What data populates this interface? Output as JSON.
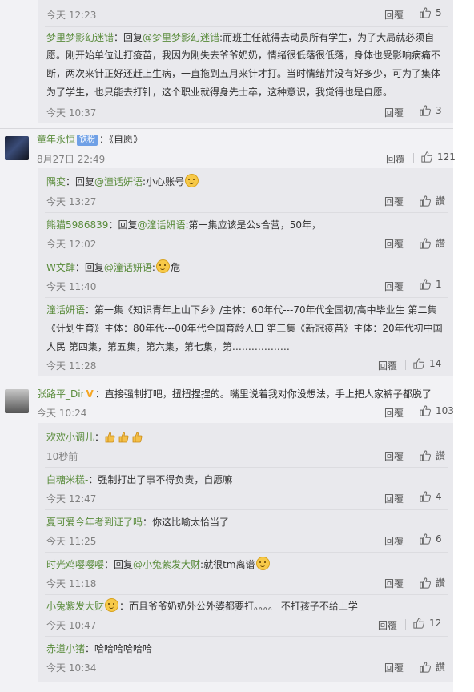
{
  "like_icon": "thumbs-up-icon",
  "reply_label": "回覆",
  "zan_label": "讚",
  "comments": [
    {
      "replies_top": [
        {
          "time": "今天 12:23",
          "likes": "5"
        },
        {
          "user": "梦里梦影幻迷错",
          "prefix": "：回复",
          "at": "@梦里梦影幻迷错",
          "text_lines": [
            ":而班主任就得去动员所有学生，为了大局就必须自",
            "愿。刚开始单位让打疫苗，我因为刚失去爷爷奶奶，情绪很低落很低落，身体也受影响病痛不",
            "断，两次来针正好还赶上生病，一直拖到五月来针才打。当时情绪并没有好多少，可为了集体",
            "为了学生，也只能去打针，这个职业就得身先士卒，这种意识，我觉得也是自愿。"
          ],
          "time": "今天 10:37",
          "likes": "3"
        }
      ]
    },
    {
      "user": "童年永恒",
      "badge": "铁粉",
      "text": "：《自愿》",
      "time": "8月27日 22:49",
      "likes": "121",
      "replies": [
        {
          "user": "隅変",
          "prefix": "：回复",
          "at": "@潼话妍语",
          "text": ":小心账号",
          "emoji": true,
          "time": "今天 13:27",
          "likes": "讚"
        },
        {
          "user": "熊猫5986839",
          "prefix": "：回复",
          "at": "@潼话妍语",
          "text": ":第一集应该是公s合营，50年，",
          "time": "今天 12:02",
          "likes": "讚"
        },
        {
          "user": "W文肆",
          "prefix": "：回复",
          "at": "@潼话妍语",
          "text": ":",
          "emoji": true,
          "text2": "危",
          "time": "今天 11:40",
          "likes": "1"
        },
        {
          "user": "潼话妍语",
          "text_lines": [
            "：第一集《知识青年上山下乡》/主体：60年代---70年代全国初/高中毕业生 第二集",
            "《计划生育》主体：80年代---00年代全国育龄人口 第三集《新冠疫苗》主体：20年代初中国",
            "人民 第四集，第五集，第六集，第七集，第………………"
          ],
          "time": "今天 11:28",
          "likes": "14"
        }
      ]
    },
    {
      "user": "张路平_Dir",
      "vbadge": "V",
      "text": "：直接强制打吧，扭扭捏捏的。嘴里说着我对你没想法，手上把人家裤子都脱了",
      "time": "今天 10:24",
      "likes": "103",
      "replies": [
        {
          "user": "欢欢小调儿",
          "text": "：",
          "thumbs": 3,
          "time": "10秒前",
          "likes": "讚"
        },
        {
          "user": "白糖米糕-",
          "text": "：强制打出了事不得负责，自愿嘛",
          "time": "今天 12:47",
          "likes": "4"
        },
        {
          "user": "夏可爱今年考到证了吗",
          "text": "：你这比喻太恰当了",
          "time": "今天 11:25",
          "likes": "6"
        },
        {
          "user": "时光鸡嘤嘤嘤",
          "prefix": "：回复",
          "at": "@小兔紫发大财",
          "text": ":就很tm离谱",
          "emoji": true,
          "time": "今天 11:18",
          "likes": "讚"
        },
        {
          "user": "小兔紫发大财",
          "emoji_after_user": true,
          "text": "：而且爷爷奶奶外公外婆都要打。。。。 不打孩子不给上学",
          "time": "今天 10:47",
          "likes": "12"
        },
        {
          "user": "赤道小猪",
          "text": "：哈哈哈哈哈哈",
          "time": "今天 10:34",
          "likes": "讚"
        }
      ]
    }
  ]
}
